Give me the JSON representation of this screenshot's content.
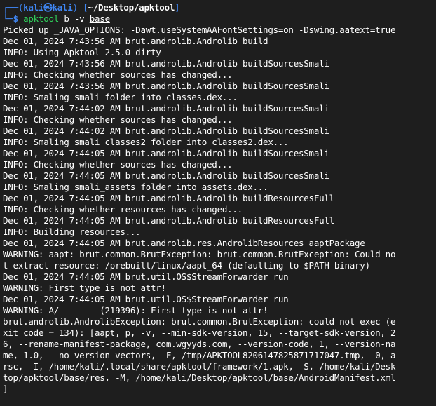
{
  "prompt": {
    "corner_top": "┌──(",
    "user": "kali",
    "at_symbol": "㉿",
    "host": "kali",
    "mid": ")-[",
    "cwd": "~/Desktop/apktool",
    "end": "]",
    "corner_bottom": "└─",
    "dollar": "$",
    "command": "apktool",
    "arg1": "b",
    "option": "-v",
    "target": "base"
  },
  "output": [
    "Picked up _JAVA_OPTIONS: -Dawt.useSystemAAFontSettings=on -Dswing.aatext=true",
    "Dec 01, 2024 7:43:56 AM brut.androlib.Androlib build",
    "INFO: Using Apktool 2.5.0-dirty",
    "Dec 01, 2024 7:43:56 AM brut.androlib.Androlib buildSourcesSmali",
    "INFO: Checking whether sources has changed...",
    "Dec 01, 2024 7:43:56 AM brut.androlib.Androlib buildSourcesSmali",
    "INFO: Smaling smali folder into classes.dex...",
    "Dec 01, 2024 7:44:02 AM brut.androlib.Androlib buildSourcesSmali",
    "INFO: Checking whether sources has changed...",
    "Dec 01, 2024 7:44:02 AM brut.androlib.Androlib buildSourcesSmali",
    "INFO: Smaling smali_classes2 folder into classes2.dex...",
    "Dec 01, 2024 7:44:05 AM brut.androlib.Androlib buildSourcesSmali",
    "INFO: Checking whether sources has changed...",
    "Dec 01, 2024 7:44:05 AM brut.androlib.Androlib buildSourcesSmali",
    "INFO: Smaling smali_assets folder into assets.dex...",
    "Dec 01, 2024 7:44:05 AM brut.androlib.Androlib buildResourcesFull",
    "INFO: Checking whether resources has changed...",
    "Dec 01, 2024 7:44:05 AM brut.androlib.Androlib buildResourcesFull",
    "INFO: Building resources...",
    "Dec 01, 2024 7:44:05 AM brut.androlib.res.AndrolibResources aaptPackage",
    "WARNING: aapt: brut.common.BrutException: brut.common.BrutException: Could no",
    "t extract resource: /prebuilt/linux/aapt_64 (defaulting to $PATH binary)",
    "Dec 01, 2024 7:44:05 AM brut.util.OS$StreamForwarder run",
    "WARNING: First type is not attr!",
    "Dec 01, 2024 7:44:05 AM brut.util.OS$StreamForwarder run",
    "WARNING: A/        (219396): First type is not attr!",
    "brut.androlib.AndrolibException: brut.common.BrutException: could not exec (e",
    "xit code = 134): [aapt, p, -v, --min-sdk-version, 15, --target-sdk-version, 2",
    "6, --rename-manifest-package, com.wgyyds.com, --version-code, 1, --version-na",
    "me, 1.0, --no-version-vectors, -F, /tmp/APKTOOL8206147825871717047.tmp, -0, a",
    "rsc, -I, /home/kali/.local/share/apktool/framework/1.apk, -S, /home/kali/Desk",
    "top/apktool/base/res, -M, /home/kali/Desktop/apktool/base/AndroidManifest.xml",
    "]"
  ],
  "colors": {
    "background": "#1e1e1e",
    "prompt_blue": "#3f86f3",
    "command_green": "#2fd35b",
    "text": "#ffffff"
  }
}
